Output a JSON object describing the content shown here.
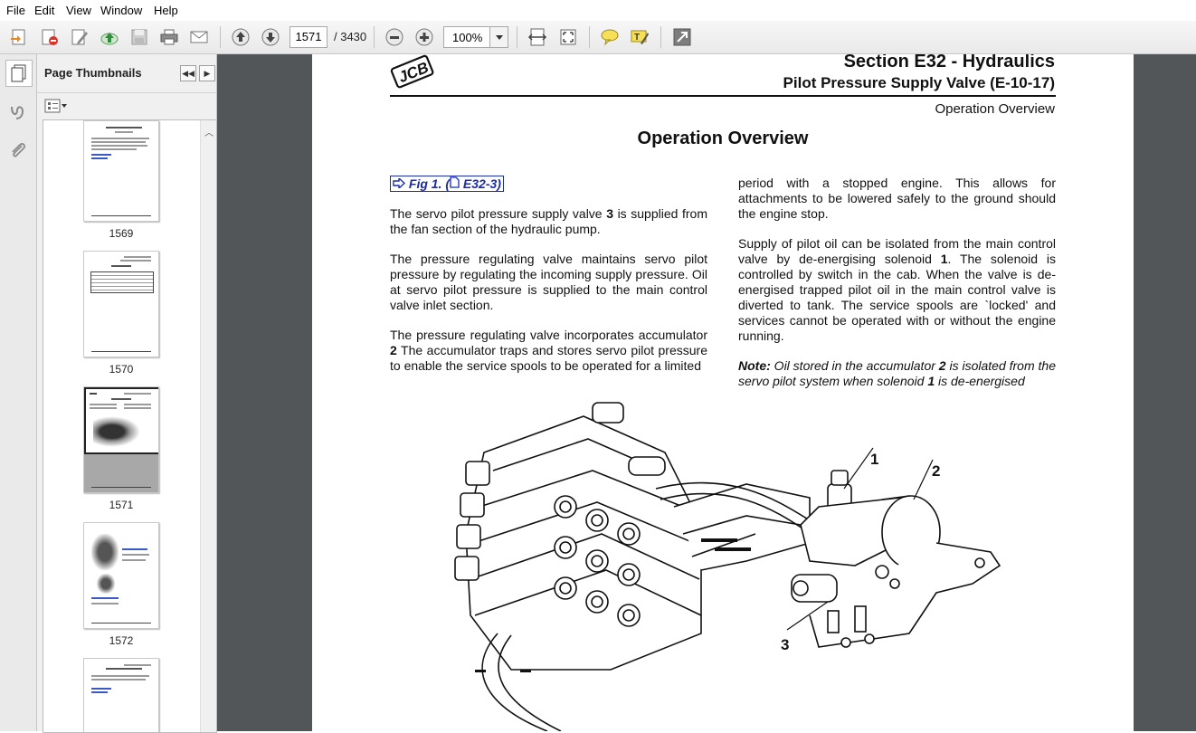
{
  "menu": [
    "File",
    "Edit",
    "View",
    "Window",
    "Help"
  ],
  "toolbar": {
    "page_current": "1571",
    "page_total": "/ 3430",
    "zoom": "100%",
    "icons": [
      "create-icon",
      "export-icon",
      "edit-icon",
      "upload-icon",
      "save-icon",
      "print-icon",
      "email-icon",
      "page-up-icon",
      "page-down-icon",
      "zoom-out-icon",
      "zoom-in-icon",
      "fit-width-icon",
      "fit-page-icon",
      "comment-icon",
      "highlight-icon",
      "expand-icon"
    ]
  },
  "sidebar": {
    "title": "Page Thumbnails",
    "thumbnails": [
      {
        "label": "1569"
      },
      {
        "label": "1570"
      },
      {
        "label": "1571",
        "selected": true
      },
      {
        "label": "1572"
      }
    ]
  },
  "document": {
    "section": "Section E32 - Hydraulics",
    "subsection": "Pilot Pressure Supply Valve (E-10-17)",
    "header_small": "Operation Overview",
    "title": "Operation Overview",
    "fig_link": "Fig 1. (",
    "fig_ref": "E32-3)",
    "left_col": {
      "p1_a": "The servo pilot pressure supply valve ",
      "p1_num": "3",
      "p1_b": " is supplied from the fan section of the hydraulic pump.",
      "p2": "The pressure regulating valve maintains servo pilot pressure by regulating the incoming supply pressure. Oil at servo pilot pressure is supplied to the main control valve inlet section.",
      "p3_a": "The pressure regulating valve incorporates accumulator ",
      "p3_num": "2",
      "p3_b": " The accumulator traps and stores servo pilot pressure to enable the service spools to be operated for a limited"
    },
    "right_col": {
      "p1": "period with a stopped engine. This allows for attachments to be lowered safely to the ground should the engine stop.",
      "p2_a": "Supply of pilot oil can be isolated from the main control valve by de-energising solenoid ",
      "p2_num": "1",
      "p2_b": ". The solenoid is controlled by switch in the cab. When the valve is de-energised trapped pilot oil in the main control valve is diverted to tank. The service spools are `locked' and services cannot be operated with or without the engine running.",
      "note_label": "Note:",
      "note_a": " Oil stored in the accumulator ",
      "note_num1": "2",
      "note_b": " is isolated from the servo pilot system when solenoid ",
      "note_num2": "1",
      "note_c": " is de-energised"
    },
    "callouts": [
      "1",
      "2",
      "3"
    ]
  }
}
